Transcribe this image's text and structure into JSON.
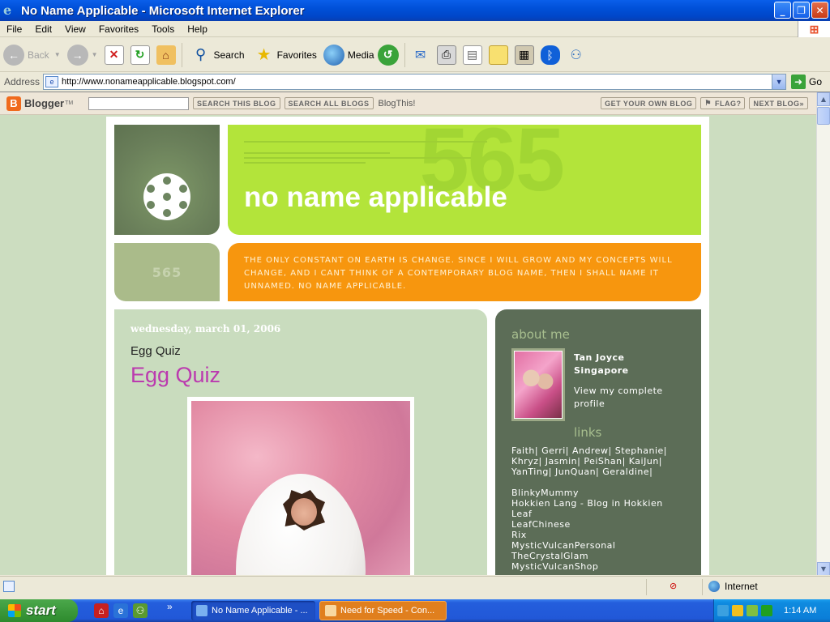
{
  "window": {
    "title": "No Name Applicable - Microsoft Internet Explorer",
    "min": "_",
    "max": "❐",
    "close": "✕"
  },
  "menu": [
    "File",
    "Edit",
    "View",
    "Favorites",
    "Tools",
    "Help"
  ],
  "toolbar": {
    "back": "Back",
    "search": "Search",
    "favorites": "Favorites",
    "media": "Media"
  },
  "address": {
    "label": "Address",
    "url": "http://www.nonameapplicable.blogspot.com/",
    "go": "Go"
  },
  "bloggerbar": {
    "logo": "Blogger",
    "tm": "TM",
    "search_blog": "SEARCH THIS BLOG",
    "search_all": "SEARCH ALL BLOGS",
    "blogthis": "BlogThis!",
    "get_own": "GET YOUR OWN BLOG",
    "flag": "FLAG?",
    "next": "NEXT BLOG»"
  },
  "header": {
    "title": "no name applicable",
    "number": "565",
    "tagline": "the only constant on earth is change. since i will grow and my concepts will change, and i cant think of a contemporary blog name, then i shall name it unnamed. no name applicable."
  },
  "post": {
    "date": "wednesday, march 01, 2006",
    "title": "Egg Quiz",
    "heading": "Egg Quiz"
  },
  "sidebar": {
    "about_heading": "about me",
    "name": "Tan Joyce",
    "location": "Singapore",
    "view_profile": "View my complete profile",
    "links_heading": "links",
    "friend_lines": [
      "Faith| Gerri| Andrew| Stephanie|",
      "Khryz| Jasmin| PeiShan| KaiJun|",
      "YanTing| JunQuan| Geraldine|"
    ],
    "links": [
      "BlinkyMummy",
      "Hokkien Lang - Blog in Hokkien",
      "Leaf",
      "LeafChinese",
      "Rix",
      "MysticVulcanPersonal",
      "TheCrystalGlam",
      "MysticVulcanShop"
    ]
  },
  "status": {
    "zone": "Internet"
  },
  "taskbar": {
    "start": "start",
    "task1": "No Name Applicable - ...",
    "task2": "Need for Speed - Con...",
    "more": "»",
    "clock": "1:14 AM"
  }
}
